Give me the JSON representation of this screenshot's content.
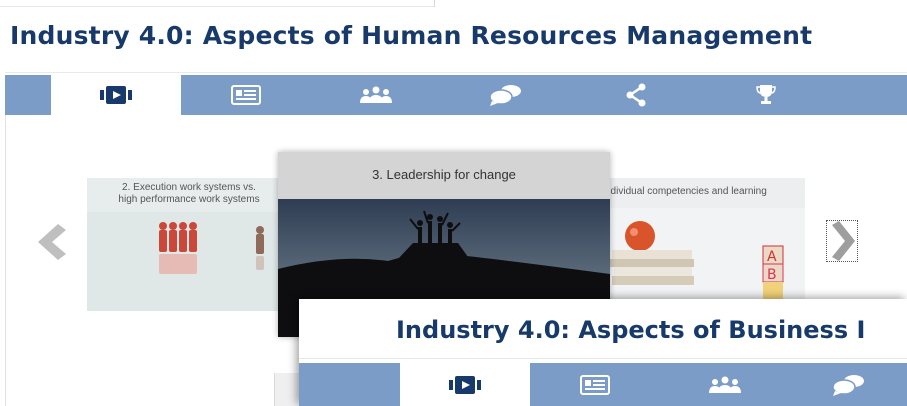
{
  "page": {
    "title": "Industry 4.0: Aspects of Human Resources Management"
  },
  "tabs": [
    {
      "id": "video",
      "icon": "video-icon",
      "active": true
    },
    {
      "id": "text",
      "icon": "newspaper-icon",
      "active": false
    },
    {
      "id": "people",
      "icon": "group-icon",
      "active": false
    },
    {
      "id": "chat",
      "icon": "chat-bubbles-icon",
      "active": false
    },
    {
      "id": "share",
      "icon": "share-icon",
      "active": false
    },
    {
      "id": "trophy",
      "icon": "trophy-icon",
      "active": false
    }
  ],
  "carousel": {
    "prev_icon": "chevron-left-icon",
    "next_icon": "chevron-right-icon",
    "cards": [
      {
        "caption_line1": "2. Execution work systems vs.",
        "caption_line2": "high performance work systems",
        "image": "red-pawns-and-single-pawn"
      },
      {
        "caption": "3. Leadership for change",
        "image": "people-celebrating-on-rock-at-sunset"
      },
      {
        "caption": "ndividual competencies and learning",
        "image": "apple-books-and-abc-blocks"
      }
    ]
  },
  "overlay_window": {
    "title": "Industry 4.0: Aspects of Business I",
    "tabs": [
      {
        "icon": "video-icon",
        "active": true
      },
      {
        "icon": "newspaper-icon",
        "active": false
      },
      {
        "icon": "group-icon",
        "active": false
      },
      {
        "icon": "chat-bubbles-icon",
        "active": false
      }
    ]
  },
  "colors": {
    "title": "#173a6b",
    "tabbar": "#7b9cc6",
    "icon": "#ffffff",
    "active_icon": "#173a6b"
  }
}
